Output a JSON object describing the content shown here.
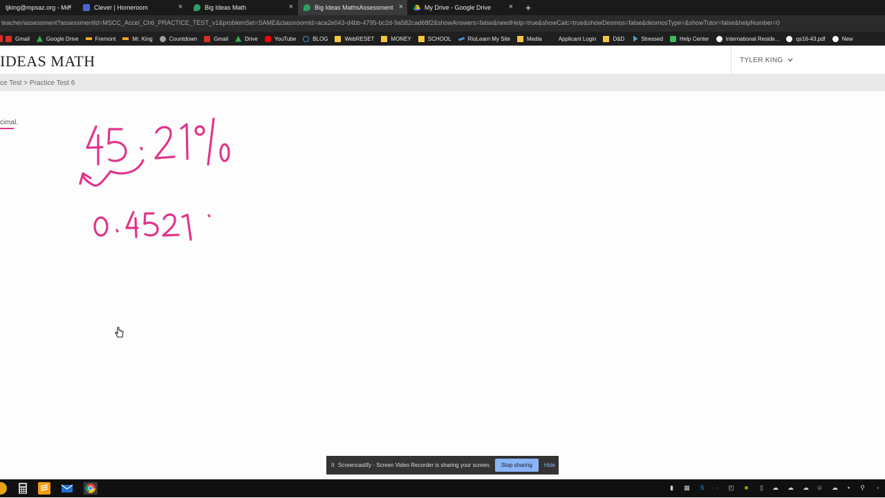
{
  "browser": {
    "tabs": [
      {
        "label": "tjking@mpsaz.org - Mes",
        "icon_color": "#ffffff"
      },
      {
        "label": "Clever | Homeroom",
        "icon_color": "#4a66d6"
      },
      {
        "label": "Big Ideas Math",
        "icon_color": "#2e9d6a"
      },
      {
        "label": "Big Ideas MathsAssessment",
        "icon_color": "#2e9d6a"
      },
      {
        "label": "My Drive - Google Drive",
        "icon_color": "#f4b400"
      }
    ],
    "close_glyph": "×",
    "new_tab_glyph": "+",
    "url": "teacher/assessment?assessmentId=MSCC_Accel_Ch6_PRACTICE_TEST_v1&problemSet=SAME&classroomId=aca2e043-d4bb-4795-bc2d-9a582cad68f2&showAnswers=false&needHelp=true&showCalc=true&showDesmos=false&desmosType=&showTutor=false&helpNumber=0",
    "bookmarks": [
      {
        "label": "Gmail",
        "icon_color": "#d93025"
      },
      {
        "label": "Google Drive",
        "icon_color": "#34a853"
      },
      {
        "label": "Fremont",
        "icon_color": "#f5a623"
      },
      {
        "label": "Mr. King",
        "icon_color": "#f5a623"
      },
      {
        "label": "Countdown",
        "icon_color": "#9aa0a6"
      },
      {
        "label": "Gmail",
        "icon_color": "#d93025"
      },
      {
        "label": "Drive",
        "icon_color": "#34a853"
      },
      {
        "label": "YouTube",
        "icon_color": "#ff0000"
      },
      {
        "label": "BLOG",
        "icon_color": "#4a90e2"
      },
      {
        "label": "WebRESET",
        "icon_color": "#f4c542"
      },
      {
        "label": "MONEY",
        "icon_color": "#f4c542"
      },
      {
        "label": "SCHOOL",
        "icon_color": "#f4c542"
      },
      {
        "label": "RioLearn My Site",
        "icon_color": "#4a90e2"
      },
      {
        "label": "Media",
        "icon_color": "#f4c542"
      },
      {
        "label": "Applicant Login",
        "icon_color": "#222222"
      },
      {
        "label": "D&D",
        "icon_color": "#f4c542"
      },
      {
        "label": "Stressed",
        "icon_color": "#5aa0d0"
      },
      {
        "label": "Help Center",
        "icon_color": "#3dbb5e"
      },
      {
        "label": "International Reside...",
        "icon_color": "#ffffff"
      },
      {
        "label": "qs16-43.pdf",
        "icon_color": "#ffffff"
      },
      {
        "label": "New",
        "icon_color": "#ffffff"
      }
    ]
  },
  "app": {
    "logo": "IDEAS MATH",
    "user_name": "TYLER KING",
    "user_chevron": "⌄",
    "breadcrumb": "ce Test > Practice Test 6",
    "question_fragment": "cimal.",
    "ink_color": "#e0348a"
  },
  "share_bar": {
    "pause_glyph": "II",
    "text": "Screencastify - Screen Video Recorder is sharing your screen.",
    "stop_label": "Stop sharing",
    "hide_label": "Hide"
  },
  "taskbar": {
    "apps": [
      {
        "name": "chrome-icon",
        "color": "#e8a317"
      },
      {
        "name": "calculator-icon",
        "color": "#cccccc"
      },
      {
        "name": "sublime-icon",
        "color": "#f39c12"
      },
      {
        "name": "mail-icon",
        "color": "#1e6fd0"
      },
      {
        "name": "chrome-icon",
        "color": "#db4437"
      }
    ]
  }
}
